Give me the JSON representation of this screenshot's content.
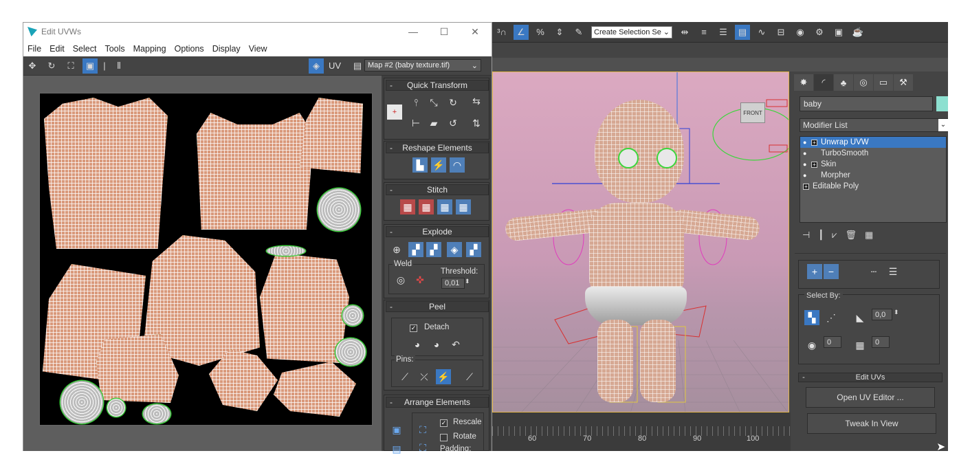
{
  "uvw_window": {
    "title": "Edit UVWs",
    "menu": [
      "File",
      "Edit",
      "Select",
      "Tools",
      "Mapping",
      "Options",
      "Display",
      "View"
    ],
    "uv_label": "UV",
    "map_select": "Map #2 (baby texture.tif)",
    "panels": {
      "quick_transform": "Quick Transform",
      "reshape_elements": "Reshape Elements",
      "stitch": "Stitch",
      "explode": "Explode",
      "weld_label": "Weld",
      "threshold_label": "Threshold:",
      "threshold_value": "0,01",
      "peel": "Peel",
      "detach_label": "Detach",
      "detach_checked": true,
      "pins_label": "Pins:",
      "arrange_elements": "Arrange Elements",
      "rescale_label": "Rescale",
      "rescale_checked": true,
      "rotate_label": "Rotate",
      "rotate_checked": false,
      "padding_label": "Padding:"
    }
  },
  "max": {
    "toolbar": {
      "selection_set": "Create Selection Se",
      "snap_percent": "%"
    },
    "viewport": {
      "viewcube_label": "FRONT"
    },
    "timeline": {
      "ticks": [
        "60",
        "70",
        "80",
        "90",
        "100"
      ]
    },
    "command_panel": {
      "object_name": "baby",
      "object_color": "#8de0d0",
      "modifier_list": "Modifier List",
      "stack": [
        {
          "label": "Unwrap UVW",
          "selected": true,
          "expandable": true
        },
        {
          "label": "TurboSmooth",
          "selected": false,
          "expandable": false
        },
        {
          "label": "Skin",
          "selected": false,
          "expandable": true
        },
        {
          "label": "Morpher",
          "selected": false,
          "expandable": false
        },
        {
          "label": "Editable Poly",
          "selected": false,
          "expandable": true
        }
      ],
      "select_by_label": "Select By:",
      "select_by_value": "0,0",
      "spin_a": "0",
      "spin_b": "0",
      "edit_uvs_header": "Edit UVs",
      "open_uv_editor": "Open UV Editor ...",
      "tweak_in_view": "Tweak In View"
    }
  },
  "colors": {
    "accent_blue": "#3a78c2",
    "uv_seam_green": "#3acb3a",
    "panel_bg": "#444444"
  }
}
